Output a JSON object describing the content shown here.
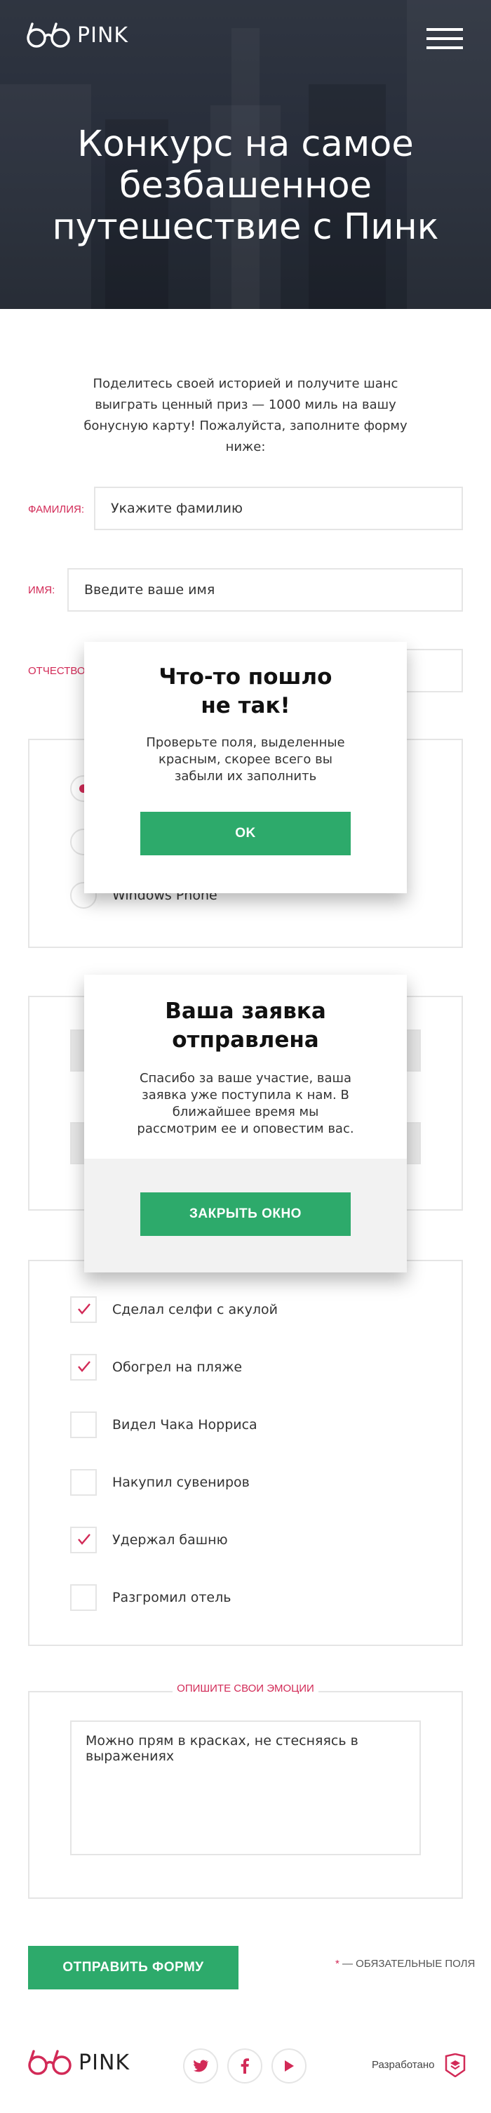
{
  "header": {
    "logo_text": "PINK",
    "menu_icon": "hamburger-icon",
    "title": "Конкурс на самое безбашенное путешествие с Пинк"
  },
  "intro": {
    "text": "Поделитесь своей историей и получите шанс выиграть ценный приз — 1000 миль на вашу бонусную карту! Пожалуйста, заполните форму ниже:"
  },
  "form": {
    "surname": {
      "label": "Фамилия:",
      "placeholder": "Укажите фамилию"
    },
    "name": {
      "label": "Имя:",
      "placeholder": "Введите ваше имя"
    },
    "patronymic": {
      "label": "Отчество:"
    },
    "radio_options": [
      {
        "label": "Windows Phone",
        "checked": false
      }
    ],
    "radio_first_checked": true,
    "checkboxes": [
      {
        "label": "Сделал селфи с акулой",
        "checked": true
      },
      {
        "label": "Обогрел на пляже",
        "checked": true
      },
      {
        "label": "Видел Чака Норриса",
        "checked": false
      },
      {
        "label": "Накупил сувениров",
        "checked": false
      },
      {
        "label": "Удержал башню",
        "checked": true
      },
      {
        "label": "Разгромил отель",
        "checked": false
      }
    ],
    "emotions": {
      "legend": "Опишите свои эмоции",
      "text": "Можно прям в красках, не стесняясь в выражениях"
    },
    "submit_label": "Отправить форму",
    "required_star": "*",
    "required_note": " — обязательные поля"
  },
  "error_modal": {
    "title": "Что-то пошло не так!",
    "text": "Проверьте поля, выделенные красным, скорее всего вы забыли их заполнить",
    "button": "OK"
  },
  "success_modal": {
    "title": "Ваша заявка отправлена",
    "text": "Спасибо за ваше участие, ваша заявка уже поступила к нам. В ближайшее время мы рассмотрим ее и оповестим вас.",
    "button": "Закрыть окно"
  },
  "footer": {
    "logo_text": "PINK",
    "social": [
      "twitter-icon",
      "facebook-icon",
      "youtube-icon"
    ],
    "dev_label": "Разработано",
    "dev_logo": "htmlacademy-logo"
  },
  "colors": {
    "accent": "#d22a57",
    "button": "#2daa6b",
    "border": "#e5e5e5",
    "hero_bg": "#2d3340"
  }
}
